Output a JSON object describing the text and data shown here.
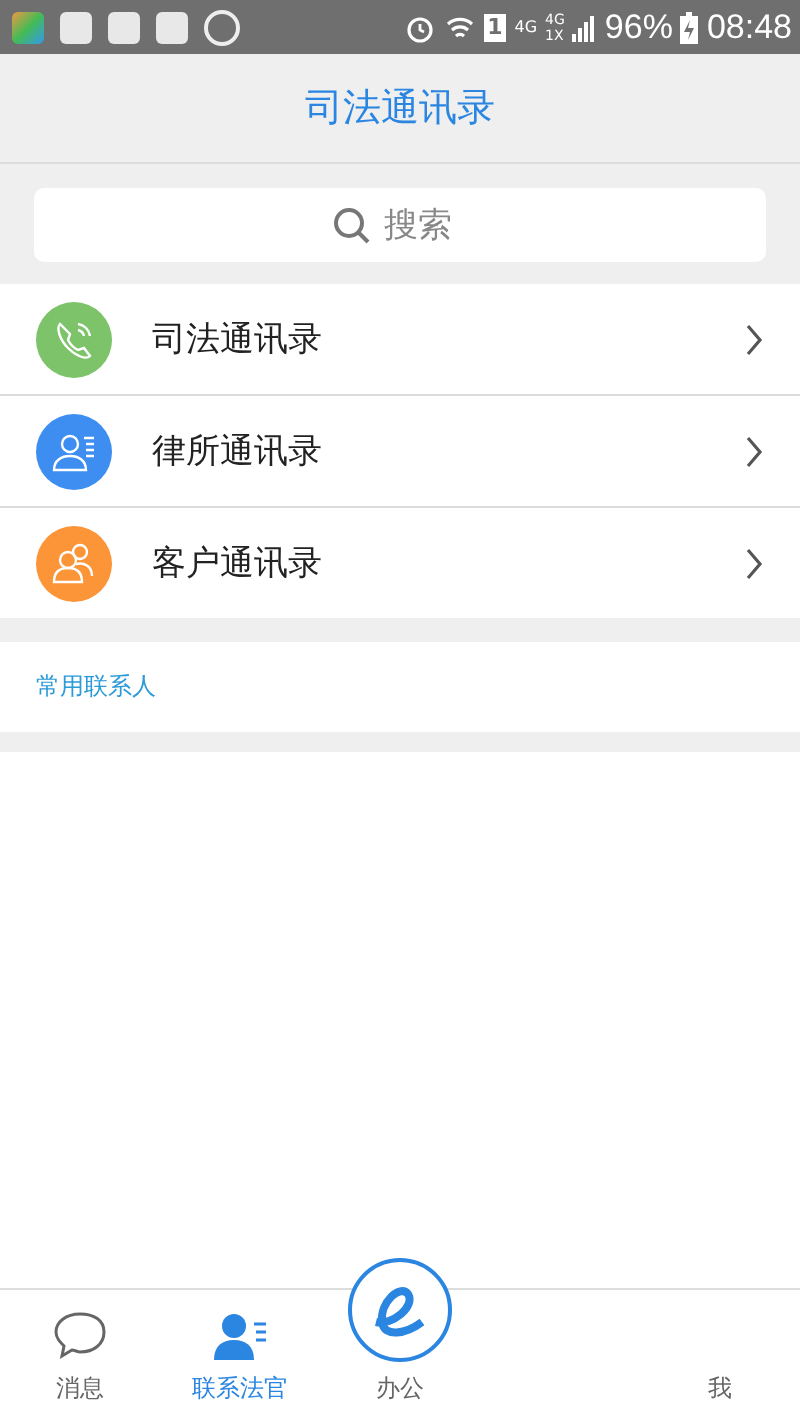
{
  "status_bar": {
    "network": "4G",
    "network_2": "4G",
    "network_3": "1X",
    "sim": "1",
    "battery": "96%",
    "time": "08:48"
  },
  "header": {
    "title": "司法通讯录"
  },
  "search": {
    "placeholder": "搜索"
  },
  "directories": [
    {
      "label": "司法通讯录",
      "kind": "phone",
      "color": "#7cc36a"
    },
    {
      "label": "律所通讯录",
      "kind": "person",
      "color": "#3d8ef0"
    },
    {
      "label": "客户通讯录",
      "kind": "group",
      "color": "#fb9538"
    }
  ],
  "frequent_contacts": {
    "title": "常用联系人"
  },
  "tabs": [
    {
      "label": "消息",
      "kind": "chat",
      "selected": false
    },
    {
      "label": "联系法官",
      "kind": "contact",
      "selected": true
    },
    {
      "label": "办公",
      "kind": "center",
      "selected": false
    },
    {
      "label": "我",
      "kind": "blank",
      "selected": false
    }
  ]
}
